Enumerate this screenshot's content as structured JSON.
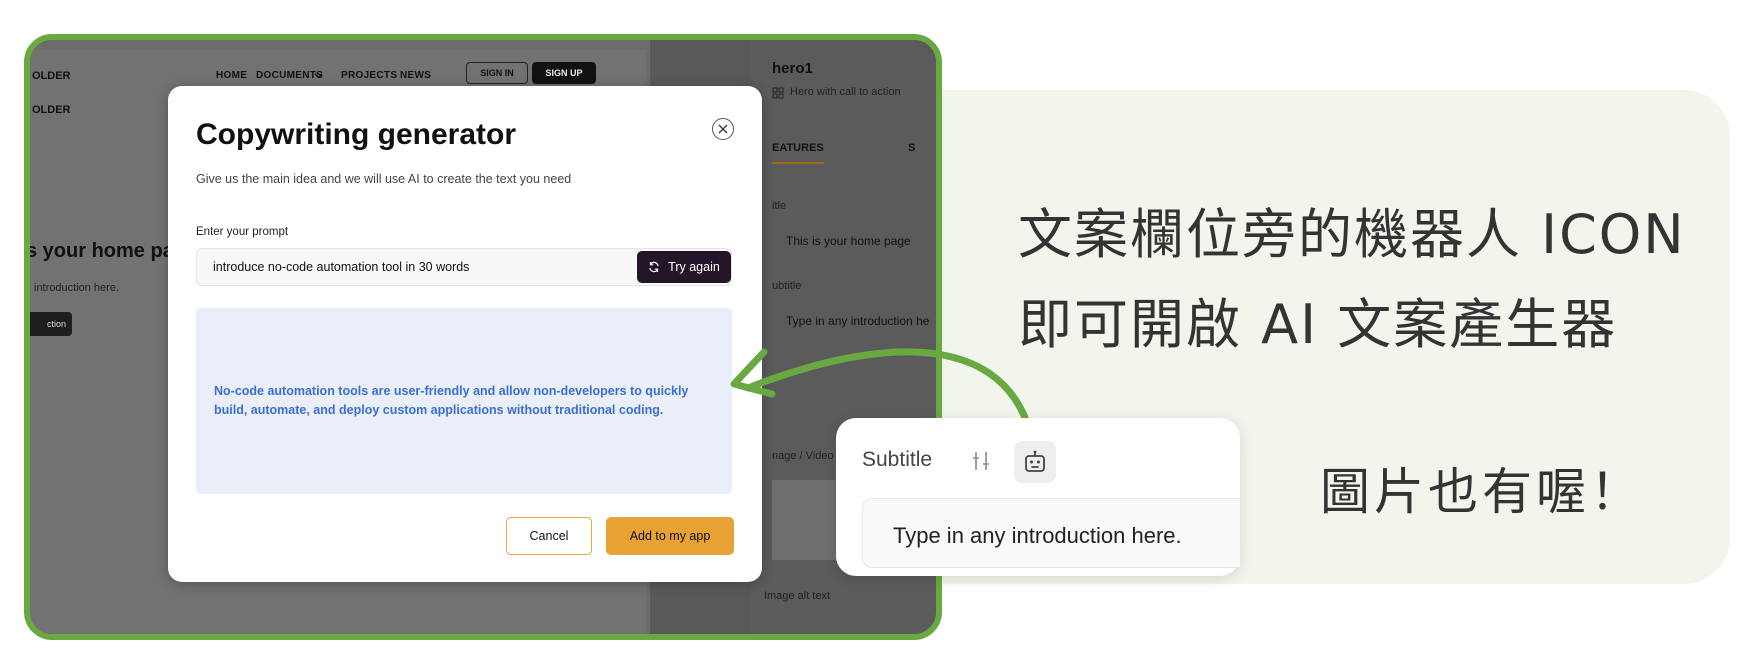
{
  "promo": {
    "line1": "文案欄位旁的機器人 ICON",
    "line2": "即可開啟 AI 文案產生器",
    "note": "圖片也有喔！"
  },
  "background_site": {
    "logo": "OLDER",
    "logo2": "OLDER",
    "nav": [
      "HOME",
      "DOCUMENTS",
      "PROJECTS",
      "NEWS"
    ],
    "signin": "SIGN IN",
    "signup": "SIGN UP",
    "hero_title": "s your home pa",
    "hero_sub": "introduction here.",
    "hero_button": "ction"
  },
  "editor": {
    "title": "hero1",
    "subtitle": "Hero with call to action",
    "tab": "EATURES",
    "tab2": "S",
    "title_label": "itle",
    "title_value": "This is your home page",
    "subtitle_label": "ubtitle",
    "subtitle_value": "Type in any introduction he",
    "image_label": "nage / Video",
    "alt_label": "Image alt text"
  },
  "modal": {
    "title": "Copywriting generator",
    "description": "Give us the main idea and we will use AI to create the text you need",
    "prompt_label": "Enter your prompt",
    "prompt_value": "introduce no-code automation tool in 30 words",
    "try_again": "Try again",
    "result": "No-code automation tools are user-friendly and allow non-developers to quickly build, automate, and deploy custom applications without traditional coding.",
    "cancel": "Cancel",
    "add": "Add to my app"
  },
  "callout": {
    "label": "Subtitle",
    "field_value": "Type in any introduction here."
  },
  "colors": {
    "frame": "#6aa842",
    "accent_orange": "#e8a133",
    "result_text": "#3b6fd4",
    "try_button": "#231628",
    "panel": "#f1f5ec"
  }
}
